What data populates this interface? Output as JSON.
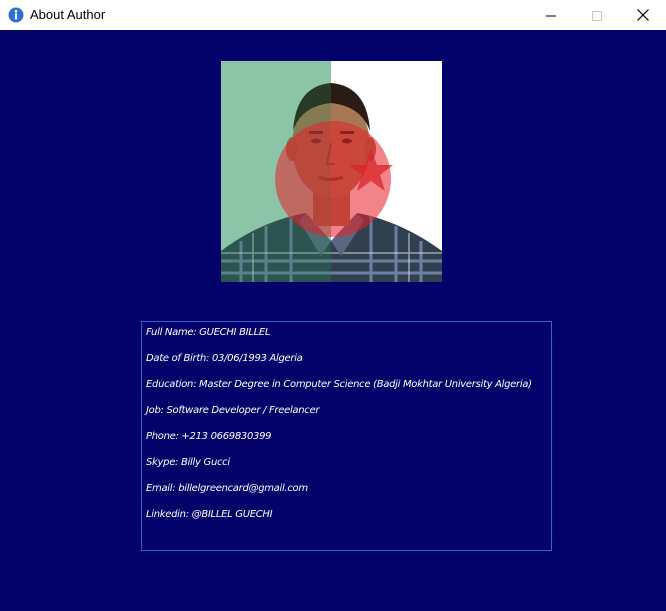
{
  "window": {
    "title": "About Author",
    "icons": {
      "app": "info-icon",
      "minimize": "minimize-icon",
      "maximize": "maximize-icon",
      "close": "close-icon"
    }
  },
  "colors": {
    "background": "#02026a",
    "box_border": "#3b5fc8",
    "text": "#ffffff"
  },
  "author": {
    "photo": "author-photo with algerian-flag overlay",
    "full_name": "Full Name: GUECHI BILLEL",
    "date_of_birth": "Date of Birth: 03/06/1993 Algeria",
    "education": "Education: Master Degree in Computer Science (Badji Mokhtar University Algeria)",
    "job": "Job: Software Developer / Freelancer",
    "phone": "Phone: +213 0669830399",
    "skype": "Skype: Billy Gucci",
    "email": "Email: billelgreencard@gmail.com",
    "linkedin": "Linkedin: @BILLEL GUECHI"
  }
}
